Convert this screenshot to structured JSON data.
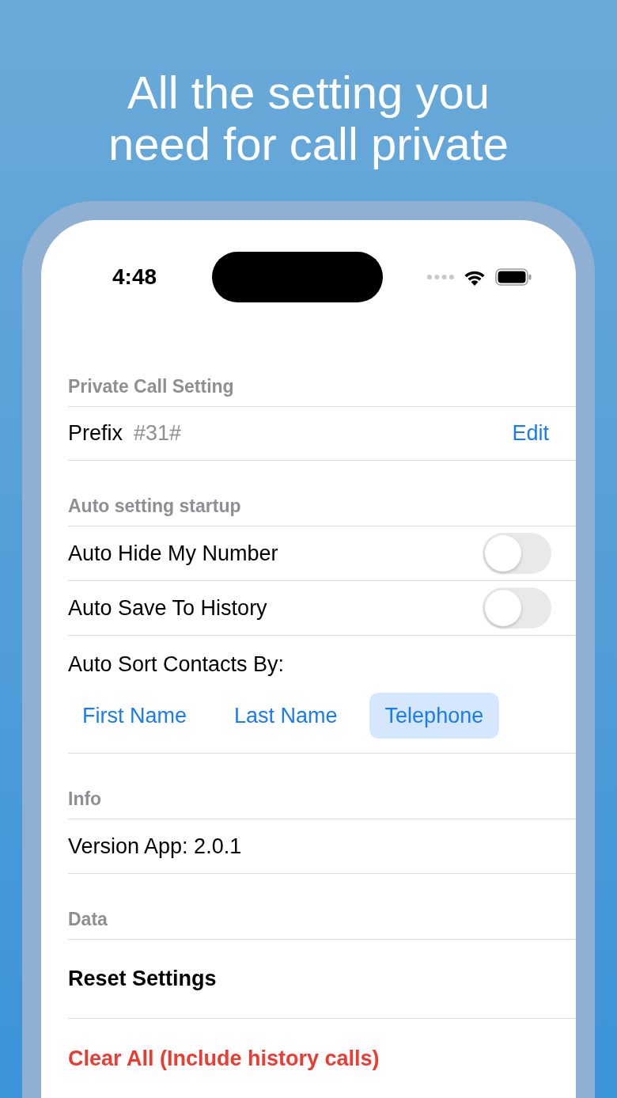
{
  "headline": [
    "All the setting you",
    "need for call private"
  ],
  "status_bar": {
    "time": "4:48"
  },
  "sections": [
    {
      "header": "Private Call Setting",
      "rows": [
        {
          "kind": "prefix",
          "label": "Prefix",
          "value": "#31#",
          "action": "Edit"
        }
      ]
    },
    {
      "header": "Auto setting startup",
      "rows": [
        {
          "kind": "toggle",
          "label": "Auto Hide My Number",
          "on": false
        },
        {
          "kind": "toggle",
          "label": "Auto Save To History",
          "on": false
        },
        {
          "kind": "segmented",
          "label": "Auto Sort Contacts By:",
          "options": [
            {
              "label": "First Name",
              "selected": false
            },
            {
              "label": "Last Name",
              "selected": false
            },
            {
              "label": "Telephone",
              "selected": true
            }
          ]
        }
      ]
    },
    {
      "header": "Info",
      "rows": [
        {
          "kind": "text",
          "label": "Version App: 2.0.1"
        }
      ]
    },
    {
      "header": "Data",
      "rows": [
        {
          "kind": "action",
          "label": "Reset Settings",
          "destructive": false
        },
        {
          "kind": "action",
          "label": "Clear All (Include history calls)",
          "destructive": true
        }
      ]
    }
  ]
}
